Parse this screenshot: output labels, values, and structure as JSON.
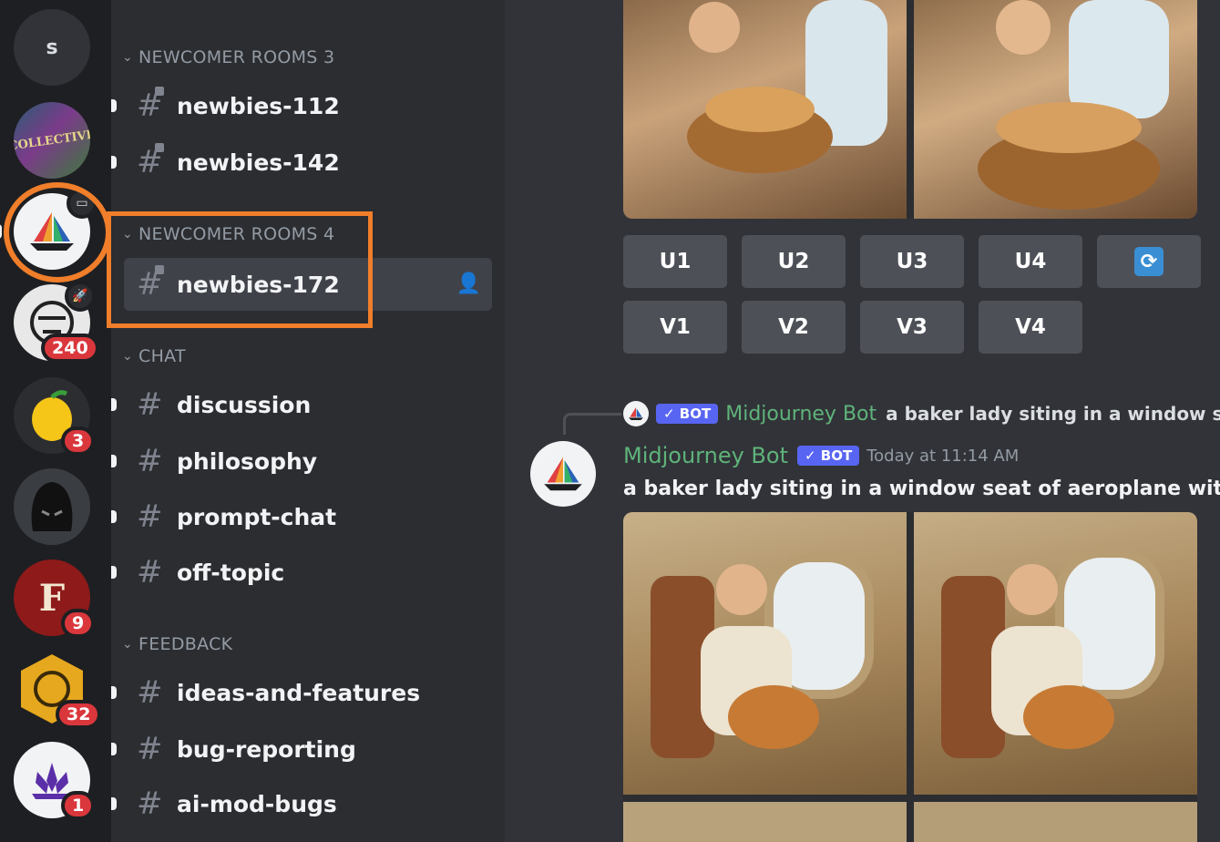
{
  "servers": [
    {
      "initial": "s",
      "badge": ""
    },
    {
      "initial": "",
      "badge": ""
    },
    {
      "initial": "",
      "badge": ""
    },
    {
      "initial": "",
      "badge": "240"
    },
    {
      "initial": "",
      "badge": "3"
    },
    {
      "initial": "",
      "badge": ""
    },
    {
      "initial": "",
      "badge": "9"
    },
    {
      "initial": "",
      "badge": "32"
    },
    {
      "initial": "",
      "badge": "1"
    }
  ],
  "categories": [
    {
      "label": "NEWCOMER ROOMS 3"
    },
    {
      "label": "NEWCOMER ROOMS 4"
    },
    {
      "label": "CHAT"
    },
    {
      "label": "FEEDBACK"
    }
  ],
  "channels": [
    {
      "name": "newbies-112"
    },
    {
      "name": "newbies-142"
    },
    {
      "name": "newbies-172"
    },
    {
      "name": "discussion"
    },
    {
      "name": "philosophy"
    },
    {
      "name": "prompt-chat"
    },
    {
      "name": "off-topic"
    },
    {
      "name": "ideas-and-features"
    },
    {
      "name": "bug-reporting"
    },
    {
      "name": "ai-mod-bugs"
    }
  ],
  "upscale_buttons": [
    "U1",
    "U2",
    "U3",
    "U4"
  ],
  "variation_buttons": [
    "V1",
    "V2",
    "V3",
    "V4"
  ],
  "message": {
    "bot_badge": "✓ BOT",
    "author": "Midjourney Bot",
    "timestamp": "Today at 11:14 AM",
    "reply_preview": "a baker lady siting in a window se",
    "text": "a baker lady siting in a window seat of aeroplane wit"
  },
  "colors": {
    "highlight": "#f07e2a",
    "bot_name": "#5fb37a",
    "bot_badge": "#5865f2",
    "badge": "#da373c"
  }
}
